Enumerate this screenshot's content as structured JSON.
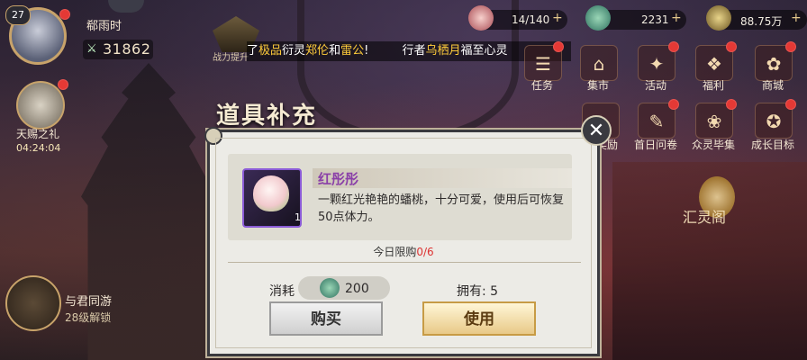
{
  "player": {
    "level": "27",
    "name": "郗雨时",
    "power": "31862"
  },
  "currencies": [
    {
      "icon": "peach-icon",
      "value": "14/140"
    },
    {
      "icon": "jade-icon",
      "value": "2231"
    },
    {
      "icon": "coin-icon",
      "value": "88.75万"
    }
  ],
  "power_hint": {
    "label": "战力提升"
  },
  "marquee": {
    "p1": "了",
    "h1": "极品",
    "p2": "衍灵",
    "h2": "郑伦",
    "p3": "和",
    "h3": "雷公",
    "p4": "!",
    "p5": "行者",
    "h4": "乌栖月",
    "p6": "福至心灵"
  },
  "left_side": {
    "gift_label": "天赐之礼",
    "gift_timer": "04:24:04",
    "travel_label": "与君同游",
    "travel_lock": "28级解锁"
  },
  "menu_row1": [
    "任务",
    "集市",
    "活动",
    "福利",
    "商城"
  ],
  "menu_row2": [
    "奖励",
    "首日问卷",
    "众灵毕集",
    "成长目标"
  ],
  "right_place": "汇灵阁",
  "dialog": {
    "title": "道具补充",
    "item_name": "红彤彤",
    "item_qty": "1",
    "item_desc": "一颗红光艳艳的蟠桃，十分可爱，使用后可恢复50点体力。",
    "limit_label": "今日限购",
    "limit_value": "0/6",
    "cost_label": "消耗",
    "cost_value": "200",
    "owned": "拥有: 5",
    "buy_label": "购买",
    "use_label": "使用",
    "close_symbol": "✕"
  }
}
